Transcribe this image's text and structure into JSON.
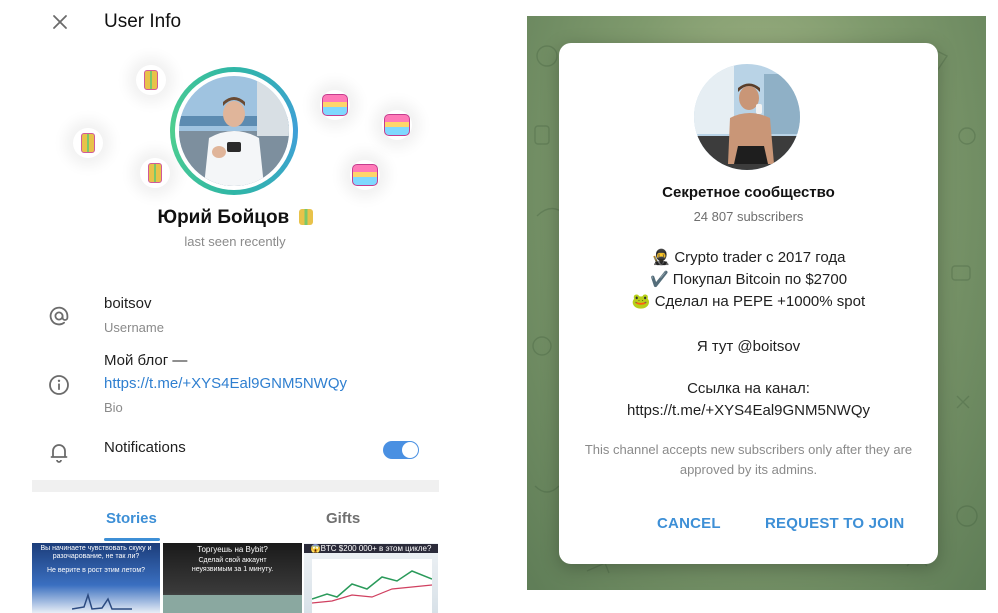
{
  "left": {
    "header": {
      "title": "User Info",
      "close_icon": "close-icon"
    },
    "profile": {
      "name": "Юрий Бойцов",
      "status": "last seen recently",
      "ring_colors": [
        "#2fb6a6",
        "#3f9fd8"
      ]
    },
    "info": {
      "username": {
        "value": "boitsov",
        "label": "Username",
        "icon": "at-icon"
      },
      "bio": {
        "line1": "Мой блог —",
        "link": "https://t.me/+XYS4Eal9GNM5NWQy",
        "label": "Bio",
        "icon": "info-icon"
      },
      "notifications": {
        "label": "Notifications",
        "icon": "bell-icon",
        "enabled": true
      }
    },
    "tabs": [
      {
        "label": "Stories",
        "active": true
      },
      {
        "label": "Gifts",
        "active": false
      }
    ],
    "stories": [
      {
        "line1": "Вы начинаете чувствовать скуку и",
        "line2": "разочарование, не так ли?",
        "line3": "Не верите в рост этим летом?"
      },
      {
        "line1": "Торгуешь на Bybit?",
        "line2": "Сделай свой аккаунт",
        "line3": "неуязвимым за 1 минуту."
      },
      {
        "line1": "😱BTC $200 000+ в этом цикле?"
      }
    ],
    "accent": "#3d8fd6"
  },
  "dialog": {
    "title": "Секретное сообщество",
    "subscribers": "24 807 subscribers",
    "lines": [
      "🥷 Crypto trader с 2017 года",
      "✔️ Покупал Bitcoin по $2700",
      "🐸 Сделал на PEPE +1000% spot"
    ],
    "here": "Я тут @boitsov",
    "link_label": "Ссылка на канал:",
    "link": "https://t.me/+XYS4Eal9GNM5NWQy",
    "note": "This channel accepts new subscribers only after they are approved by its admins.",
    "cancel_label": "CANCEL",
    "join_label": "REQUEST TO JOIN"
  }
}
